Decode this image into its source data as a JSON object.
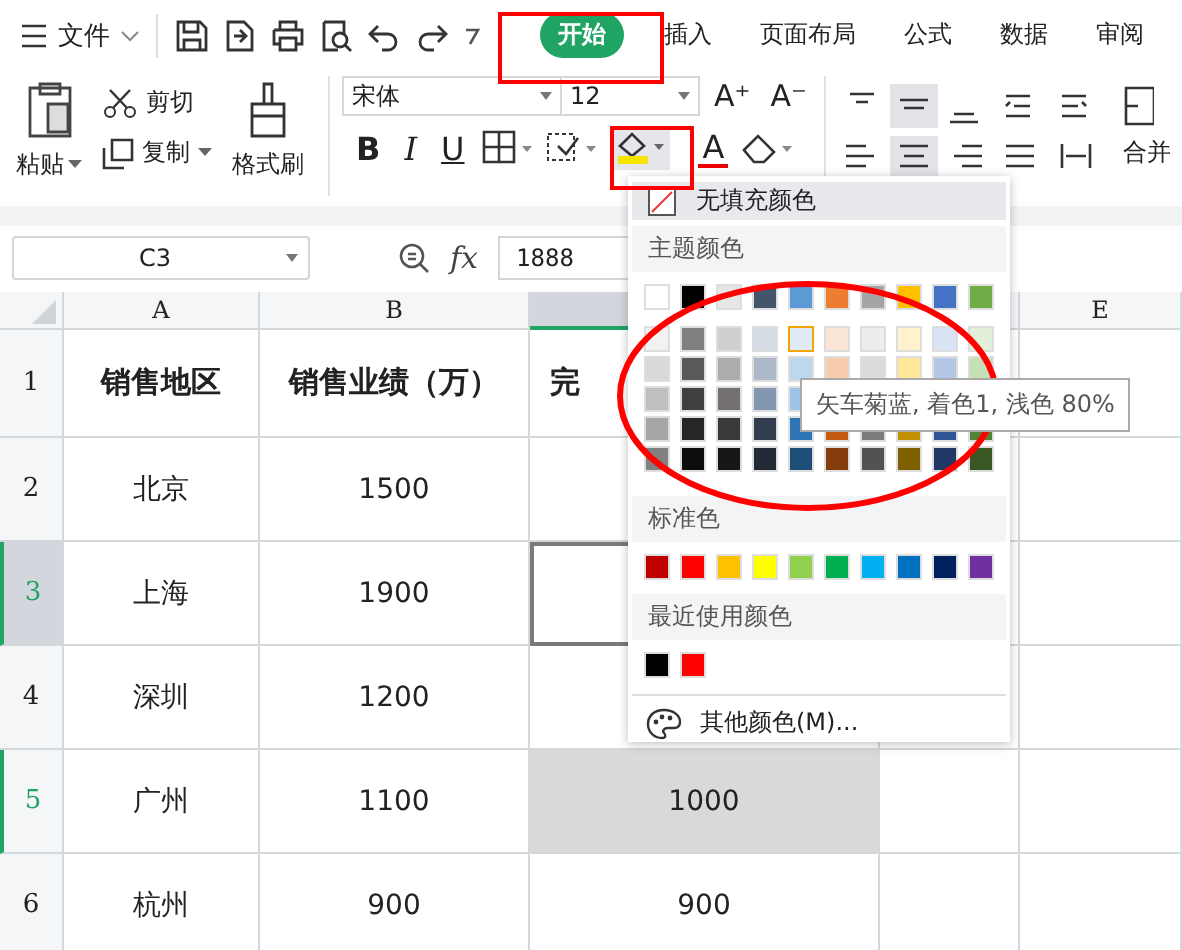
{
  "menu_bar": {
    "file_label": "文件",
    "tabs": [
      {
        "label": "开始",
        "selected": true
      },
      {
        "label": "插入",
        "selected": false
      },
      {
        "label": "页面布局",
        "selected": false
      },
      {
        "label": "公式",
        "selected": false
      },
      {
        "label": "数据",
        "selected": false
      },
      {
        "label": "审阅",
        "selected": false
      }
    ]
  },
  "ribbon": {
    "paste": "粘贴",
    "cut": "剪切",
    "copy": "复制",
    "format_painter": "格式刷",
    "font_name": "宋体",
    "font_size": "12",
    "grow_font": "A⁺",
    "shrink_font": "A⁻",
    "bold": "B",
    "italic": "I",
    "underline": "U",
    "font_color": "A",
    "merge": "合并"
  },
  "formula_bar": {
    "name_box": "C3",
    "fx": "fx",
    "value": "1888"
  },
  "sheet": {
    "columns": [
      {
        "label": "A",
        "selected": false
      },
      {
        "label": "B",
        "selected": false
      },
      {
        "selected": true
      },
      {
        "selected": false
      },
      {
        "label": "E",
        "selected": false
      }
    ],
    "rows": [
      {
        "number": "1",
        "selected": false,
        "header": true,
        "a": "销售地区",
        "b": "销售业绩（万）",
        "c": {
          "text": "完",
          "selected": false,
          "shaded": false
        }
      },
      {
        "number": "2",
        "selected": false,
        "header": false,
        "a": "北京",
        "b": "1500",
        "c": {
          "selected": false,
          "shaded": false
        }
      },
      {
        "number": "3",
        "selected": true,
        "header": false,
        "a": "上海",
        "b": "1900",
        "c": {
          "selected": true,
          "shaded": false
        }
      },
      {
        "number": "4",
        "selected": false,
        "header": false,
        "a": "深圳",
        "b": "1200",
        "c": {
          "selected": false,
          "shaded": false
        }
      },
      {
        "number": "5",
        "selected": true,
        "header": false,
        "a": "广州",
        "b": "1100",
        "c": {
          "text": "1000",
          "selected": false,
          "shaded": true
        }
      },
      {
        "number": "6",
        "selected": false,
        "header": false,
        "a": "杭州",
        "b": "900",
        "c": {
          "text": "900",
          "selected": false,
          "shaded": false
        }
      }
    ]
  },
  "fill_menu": {
    "no_fill": {
      "label": "无填充颜色",
      "highlighted": true
    },
    "theme_title": "主题颜色",
    "theme_colors": [
      {
        "color": "#ffffff"
      },
      {
        "color": "#000000"
      },
      {
        "color": "#e7e6e6"
      },
      {
        "color": "#44546a"
      },
      {
        "color": "#5b9bd5"
      },
      {
        "color": "#ed7d31"
      },
      {
        "color": "#a5a5a5"
      },
      {
        "color": "#ffc000"
      },
      {
        "color": "#4472c4"
      },
      {
        "color": "#70ad47"
      }
    ],
    "theme_shades": [
      [
        {
          "color": "#f2f2f2",
          "selected": false
        },
        {
          "color": "#7f7f7f",
          "selected": false
        },
        {
          "color": "#d0cece",
          "selected": false
        },
        {
          "color": "#d6dce5",
          "selected": false
        },
        {
          "color": "#deebf7",
          "selected": true
        },
        {
          "color": "#fbe5d6",
          "selected": false
        },
        {
          "color": "#ededed",
          "selected": false
        },
        {
          "color": "#fff2cc",
          "selected": false
        },
        {
          "color": "#dae3f3",
          "selected": false
        },
        {
          "color": "#e2f0d9",
          "selected": false
        }
      ],
      [
        {
          "color": "#d9d9d9",
          "selected": false
        },
        {
          "color": "#595959",
          "selected": false
        },
        {
          "color": "#aeabab",
          "selected": false
        },
        {
          "color": "#adb9ca",
          "selected": false
        },
        {
          "color": "#bdd7ee",
          "selected": false
        },
        {
          "color": "#f8cbad",
          "selected": false
        },
        {
          "color": "#dbdbdb",
          "selected": false
        },
        {
          "color": "#ffe699",
          "selected": false
        },
        {
          "color": "#b4c7e7",
          "selected": false
        },
        {
          "color": "#c5e0b4",
          "selected": false
        }
      ],
      [
        {
          "color": "#bfbfbf",
          "selected": false
        },
        {
          "color": "#404040",
          "selected": false
        },
        {
          "color": "#757171",
          "selected": false
        },
        {
          "color": "#8497b0",
          "selected": false
        },
        {
          "color": "#9dc3e6",
          "selected": false
        }
      ],
      [
        {
          "color": "#a6a6a6",
          "selected": false
        },
        {
          "color": "#262626",
          "selected": false
        },
        {
          "color": "#3a3838",
          "selected": false
        },
        {
          "color": "#333f50",
          "selected": false
        },
        {
          "color": "#2e75b6",
          "selected": false
        },
        {
          "color": "#c55a11",
          "selected": false
        },
        {
          "color": "#7b7b7b",
          "selected": false
        },
        {
          "color": "#bf9000",
          "selected": false
        },
        {
          "color": "#2f5597",
          "selected": false
        },
        {
          "color": "#548235",
          "selected": false
        }
      ],
      [
        {
          "color": "#808080",
          "selected": false
        },
        {
          "color": "#0d0d0d",
          "selected": false
        },
        {
          "color": "#171616",
          "selected": false
        },
        {
          "color": "#222a35",
          "selected": false
        },
        {
          "color": "#1f4e79",
          "selected": false
        },
        {
          "color": "#843c0c",
          "selected": false
        },
        {
          "color": "#525252",
          "selected": false
        },
        {
          "color": "#7f6000",
          "selected": false
        },
        {
          "color": "#203864",
          "selected": false
        },
        {
          "color": "#385723",
          "selected": false
        }
      ]
    ],
    "standard_title": "标准色",
    "standard_colors": [
      {
        "color": "#c00000"
      },
      {
        "color": "#ff0000"
      },
      {
        "color": "#ffc000"
      },
      {
        "color": "#ffff00"
      },
      {
        "color": "#92d050"
      },
      {
        "color": "#00b050"
      },
      {
        "color": "#00b0f0"
      },
      {
        "color": "#0070c0"
      },
      {
        "color": "#002060"
      },
      {
        "color": "#7030a0"
      }
    ],
    "recent_title": "最近使用颜色",
    "recent_colors": [
      {
        "color": "#000000"
      },
      {
        "color": "#ff0000"
      }
    ],
    "more_label": "其他颜色(M)...",
    "tooltip": "矢车菊蓝, 着色1, 浅色 80%"
  }
}
